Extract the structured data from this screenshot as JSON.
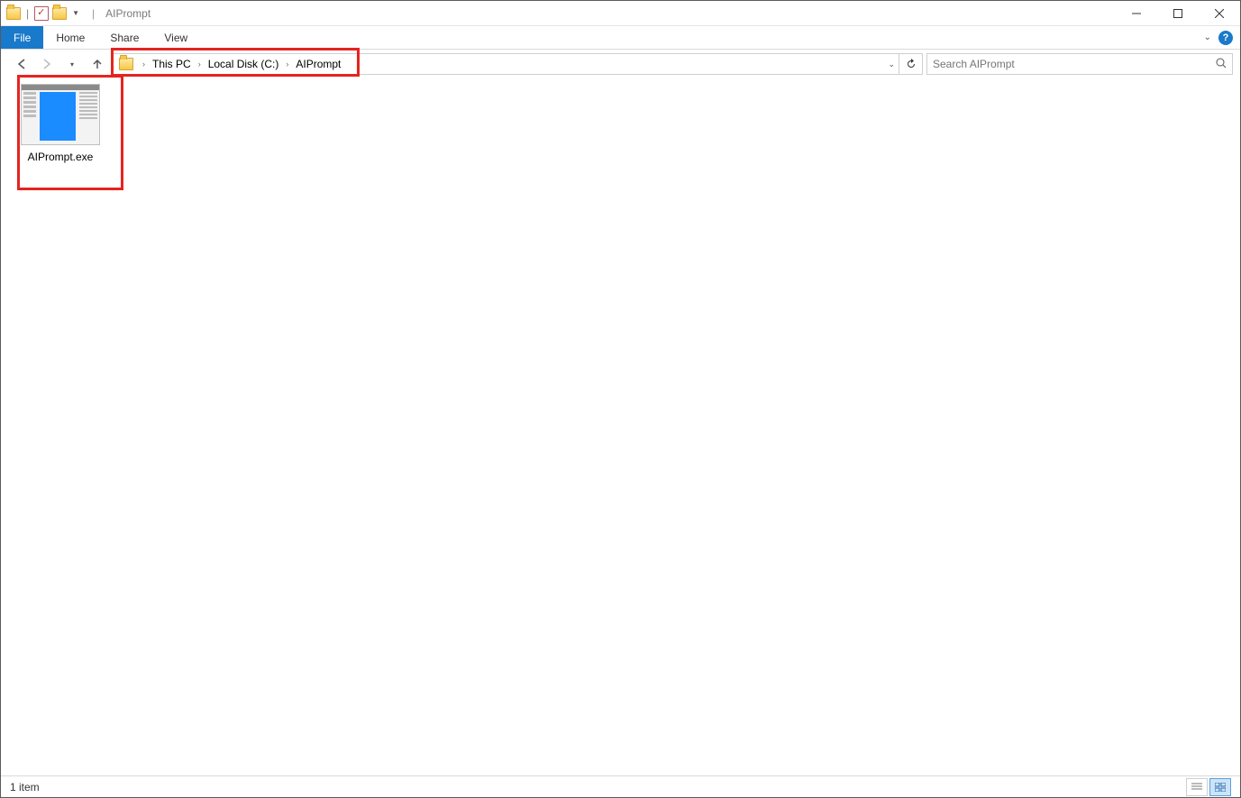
{
  "title": "AIPrompt",
  "ribbon": {
    "file": "File",
    "tabs": [
      "Home",
      "Share",
      "View"
    ]
  },
  "breadcrumbs": [
    "This PC",
    "Local Disk (C:)",
    "AIPrompt"
  ],
  "search": {
    "placeholder": "Search AIPrompt"
  },
  "files": [
    {
      "name": "AIPrompt.exe"
    }
  ],
  "statusbar": {
    "count": "1 item"
  }
}
